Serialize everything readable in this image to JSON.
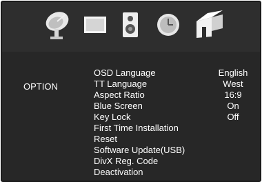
{
  "tabs": [
    {
      "icon": "satellite-dish-icon"
    },
    {
      "icon": "picture-icon"
    },
    {
      "icon": "speaker-icon"
    },
    {
      "icon": "clock-icon"
    },
    {
      "icon": "option-blocks-icon"
    }
  ],
  "section_label": "OPTION",
  "menu": [
    {
      "label": "OSD Language",
      "value": "English"
    },
    {
      "label": "TT Language",
      "value": "West"
    },
    {
      "label": "Aspect Ratio",
      "value": "16:9"
    },
    {
      "label": "Blue Screen",
      "value": "On"
    },
    {
      "label": "Key Lock",
      "value": "Off"
    },
    {
      "label": "First Time Installation",
      "value": ""
    },
    {
      "label": "Reset",
      "value": ""
    },
    {
      "label": "Software Update(USB)",
      "value": ""
    },
    {
      "label": "DivX Reg. Code",
      "value": ""
    },
    {
      "label": "Deactivation",
      "value": ""
    }
  ]
}
